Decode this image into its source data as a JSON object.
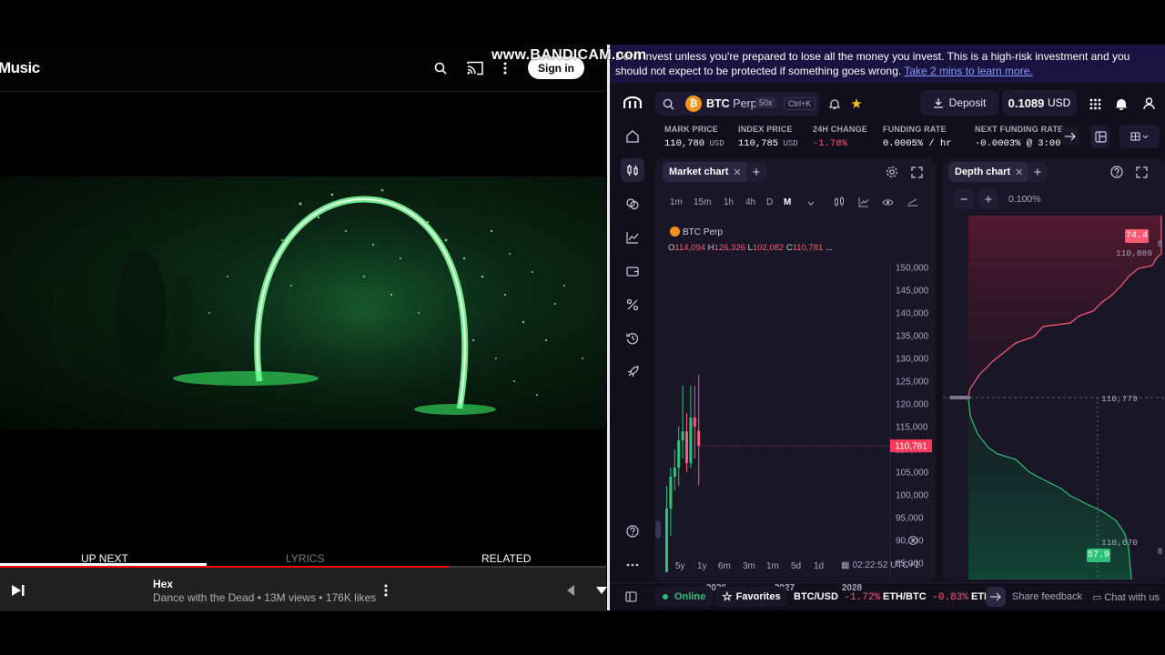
{
  "left": {
    "brand": "Music",
    "signin_label": "Sign in",
    "tabs": [
      {
        "label": "UP NEXT"
      },
      {
        "label": "LYRICS"
      },
      {
        "label": "RELATED"
      }
    ],
    "track": {
      "title": "Hex",
      "subtitle": "Dance with the Dead • 13M views • 176K likes"
    },
    "progress": 0.74
  },
  "watermark": "www.BANDICAM.com",
  "right": {
    "warning": {
      "text": "Don't invest unless you're prepared to lose all the money you invest. This is a high-risk investment and you should not expect to be protected if something goes wrong.",
      "link": "Take 2 mins to learn more."
    },
    "header": {
      "symbol": "BTC",
      "symbol_suffix": "Perp",
      "leverage": "50x",
      "shortcut": "Ctrl+K",
      "deposit_label": "Deposit",
      "balance": "0.1089",
      "currency": "USD"
    },
    "stats": [
      {
        "label": "MARK PRICE",
        "value": "110,780",
        "unit": "USD",
        "color": "#ffffff"
      },
      {
        "label": "INDEX PRICE",
        "value": "110,785",
        "unit": "USD",
        "color": "#ffffff"
      },
      {
        "label": "24H CHANGE",
        "value": "-1.78%",
        "unit": "",
        "color": "#ff5b76"
      },
      {
        "label": "FUNDING RATE",
        "value": "0.0005% / hr",
        "unit": "",
        "color": "#ffffff"
      },
      {
        "label": "NEXT FUNDING RATE",
        "value": "-0.0003% @ 3:00",
        "unit": "",
        "color": "#ffffff"
      }
    ],
    "market_chart": {
      "tab_label": "Market chart",
      "timeframes": [
        "1m",
        "15m",
        "1h",
        "4h",
        "D",
        "M"
      ],
      "active_timeframe": "M",
      "legend_name": "BTC Perp",
      "ohlc": {
        "o_label": "O",
        "o": "114,094",
        "h_label": "H",
        "h": "126,326",
        "l_label": "L",
        "l": "102,082",
        "c_label": "C",
        "c": "110,781",
        "more": "..."
      },
      "last_price_label": "110,781",
      "ranges": [
        "5y",
        "1y",
        "6m",
        "3m",
        "1m",
        "5d",
        "1d"
      ],
      "clock": "02:22:52 UTC+1"
    },
    "depth_chart": {
      "tab_label": "Depth chart",
      "zoom": "0.100%",
      "top_badge": "74.4",
      "ask_price": "110,889",
      "mid_price": "110,779",
      "bid_price": "110,670",
      "bottom_badge": "57.9",
      "edge_label": "8"
    },
    "footer": {
      "online": "Online",
      "favorites": "Favorites",
      "tickers": [
        {
          "pair": "BTC/USD",
          "change": "-1.72%"
        },
        {
          "pair": "ETH/BTC",
          "change": "-0.83%"
        },
        {
          "pair": "ETH",
          "change": ""
        }
      ],
      "feedback": "Share feedback",
      "chat": "Chat with us"
    },
    "colors": {
      "up": "#2fc07a",
      "down": "#ff5b76",
      "accent": "#7b61ff",
      "panel": "#191627",
      "bg": "#110f1c"
    }
  },
  "chart_data": {
    "type": "candlestick",
    "title": "BTC Perp",
    "x": [
      "2026",
      "2027",
      "2028"
    ],
    "ylim": [
      85000,
      150000
    ],
    "y_ticks": [
      150000,
      145000,
      140000,
      135000,
      130000,
      125000,
      120000,
      115000,
      110000,
      105000,
      100000,
      95000,
      90000,
      85000
    ],
    "last_price": 110781,
    "candles": [
      {
        "o": 83000,
        "h": 102000,
        "l": 83000,
        "c": 97000
      },
      {
        "o": 97000,
        "h": 106000,
        "l": 91000,
        "c": 104000
      },
      {
        "o": 104000,
        "h": 110000,
        "l": 101000,
        "c": 106000
      },
      {
        "o": 106000,
        "h": 115000,
        "l": 102000,
        "c": 112000
      },
      {
        "o": 112000,
        "h": 124000,
        "l": 108000,
        "c": 114000
      },
      {
        "o": 114000,
        "h": 118000,
        "l": 105000,
        "c": 107000
      },
      {
        "o": 107000,
        "h": 124000,
        "l": 106000,
        "c": 117000
      },
      {
        "o": 117000,
        "h": 124000,
        "l": 108000,
        "c": 115000
      },
      {
        "o": 114094,
        "h": 126326,
        "l": 102082,
        "c": 110781
      }
    ]
  }
}
